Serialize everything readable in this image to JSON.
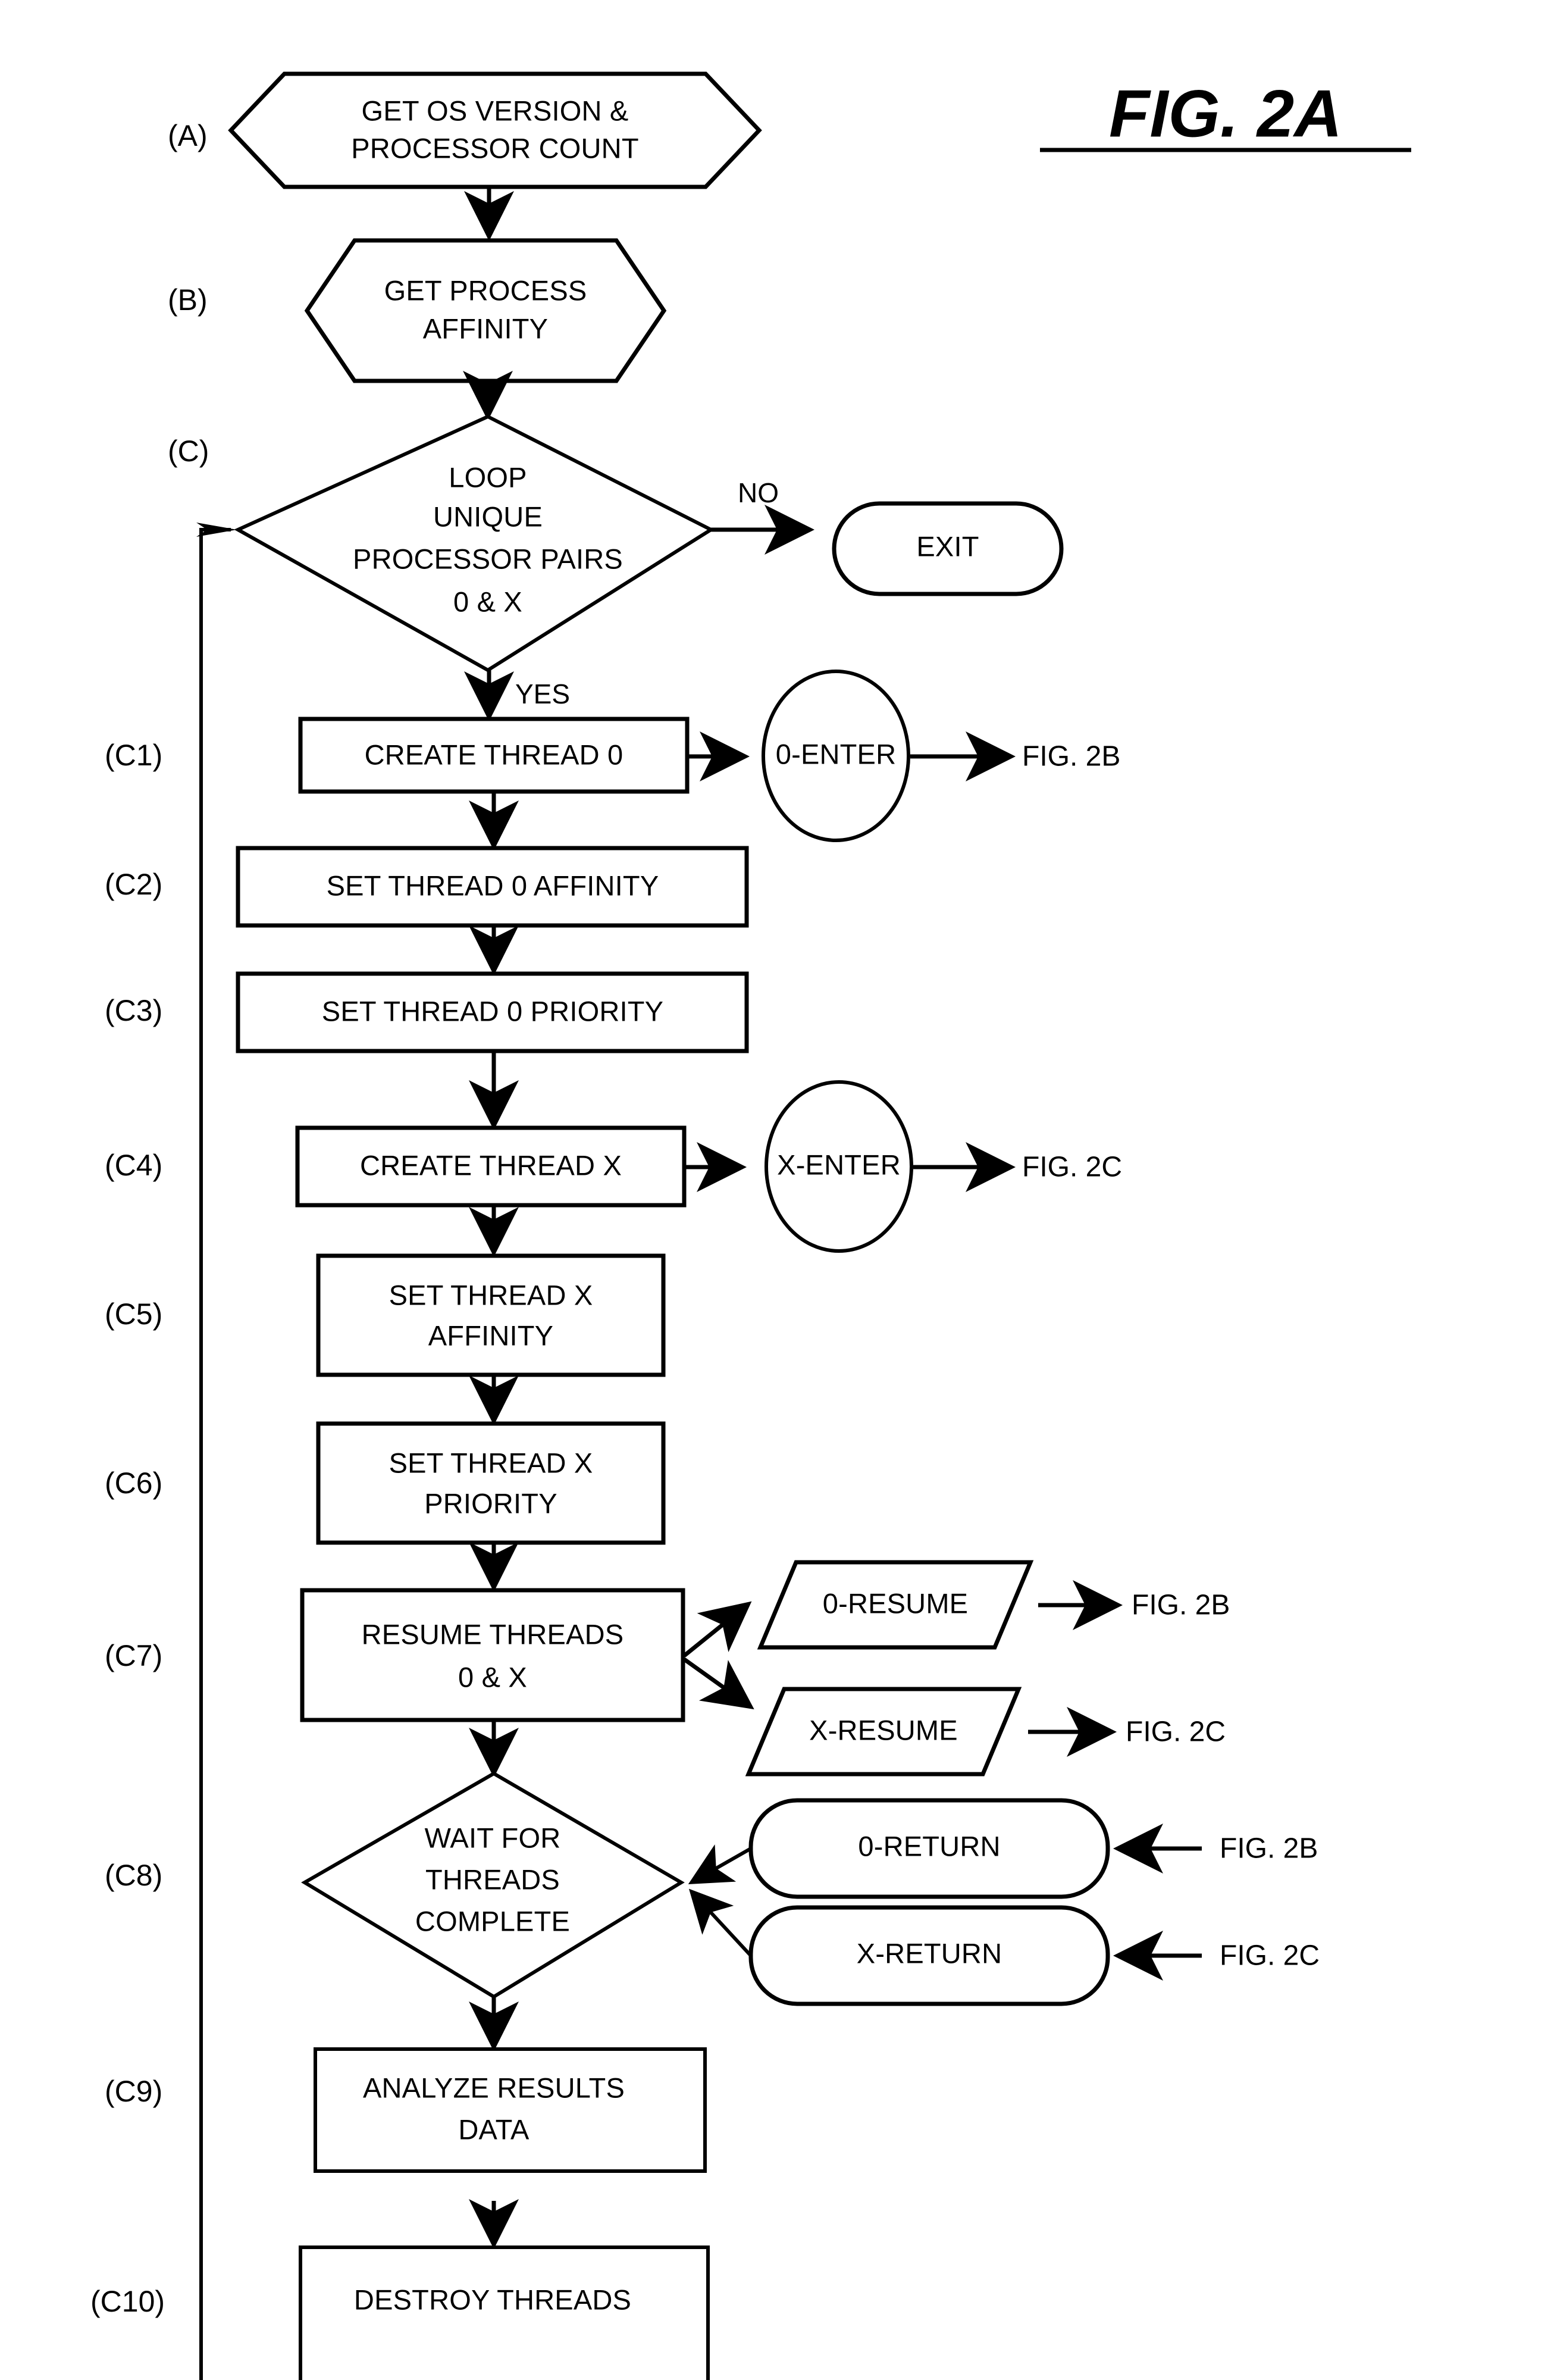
{
  "figure": {
    "title": "FIG. 2A",
    "has_title_underline": true
  },
  "step_labels": {
    "a": "(A)",
    "b": "(B)",
    "c": "(C)",
    "c1": "(C1)",
    "c2": "(C2)",
    "c3": "(C3)",
    "c4": "(C4)",
    "c5": "(C5)",
    "c6": "(C6)",
    "c7": "(C7)",
    "c8": "(C8)",
    "c9": "(C9)",
    "c10": "(C10)"
  },
  "nodes": {
    "a": {
      "shape": "hexagon",
      "line1": "GET OS VERSION &",
      "line2": "PROCESSOR COUNT"
    },
    "b": {
      "shape": "hexagon",
      "line1": "GET PROCESS",
      "line2": "AFFINITY"
    },
    "c": {
      "shape": "diamond",
      "line1": "LOOP",
      "line2": "UNIQUE",
      "line3": "PROCESSOR PAIRS",
      "line4": "0 & X"
    },
    "exit": {
      "shape": "stadium",
      "label": "EXIT"
    },
    "c1": {
      "shape": "rect",
      "label": "CREATE THREAD 0"
    },
    "c1_connector": {
      "shape": "circle",
      "label": "0-ENTER"
    },
    "c1_ref": "FIG. 2B",
    "c2": {
      "shape": "rect",
      "label": "SET THREAD 0 AFFINITY"
    },
    "c3": {
      "shape": "rect",
      "label": "SET THREAD 0 PRIORITY"
    },
    "c4": {
      "shape": "rect",
      "label": "CREATE THREAD X"
    },
    "c4_connector": {
      "shape": "circle",
      "label": "X-ENTER"
    },
    "c4_ref": "FIG. 2C",
    "c5": {
      "shape": "rect",
      "line1": "SET THREAD X",
      "line2": "AFFINITY"
    },
    "c6": {
      "shape": "rect",
      "line1": "SET THREAD X",
      "line2": "PRIORITY"
    },
    "c7": {
      "shape": "rect",
      "line1": "RESUME THREADS",
      "line2": "0 & X"
    },
    "c7_out_top": {
      "shape": "parallelogram",
      "label": "0-RESUME"
    },
    "c7_out_top_ref": "FIG. 2B",
    "c7_out_bottom": {
      "shape": "parallelogram",
      "label": "X-RESUME"
    },
    "c7_out_bottom_ref": "FIG. 2C",
    "c8": {
      "shape": "diamond",
      "line1": "WAIT FOR",
      "line2": "THREADS",
      "line3": "COMPLETE"
    },
    "c8_in_top": {
      "shape": "stadium",
      "label": "0-RETURN"
    },
    "c8_in_top_ref": "FIG. 2B",
    "c8_in_bottom": {
      "shape": "stadium",
      "label": "X-RETURN"
    },
    "c8_in_bottom_ref": "FIG. 2C",
    "c9": {
      "shape": "rect",
      "line1": "ANALYZE RESULTS",
      "line2": "DATA"
    },
    "c10": {
      "shape": "rect",
      "label": "DESTROY THREADS"
    }
  },
  "edge_labels": {
    "decision_no": "NO",
    "decision_yes": "YES"
  },
  "colors": {
    "ink": "#000000",
    "paper": "#ffffff"
  }
}
